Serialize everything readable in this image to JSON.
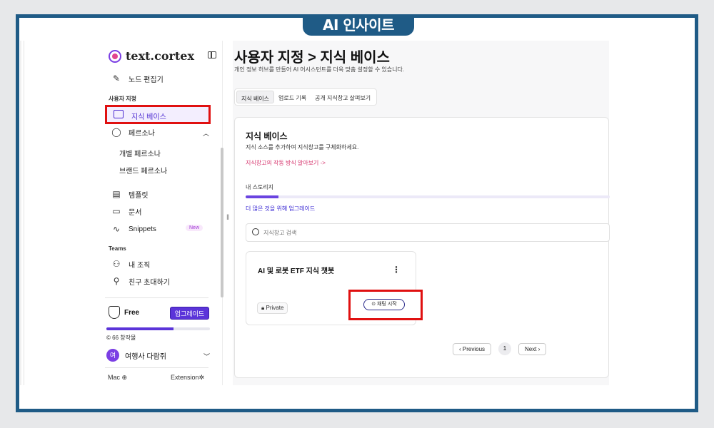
{
  "brand": {
    "label": "AI 인사이트"
  },
  "sidebar": {
    "logo_text": "text.cortex",
    "top_item": "노드 편집기",
    "section_customize": "사용자 지정",
    "active_item": "지식 베이스",
    "personas_label": "페르소나",
    "sub_items": [
      "개별 페르소나",
      "브랜드 페르소나"
    ],
    "items": [
      "템플릿",
      "문서",
      "Snippets"
    ],
    "new_badge": "New",
    "section_teams": "Teams",
    "team_items": [
      "내 조직",
      "친구 초대하기"
    ],
    "plan_name": "Free",
    "upgrade_label": "업그레이드",
    "plan_progress": 0.65,
    "credits": "© 66 창작물",
    "user_initial": "여",
    "user_name": "여행사 다람쥐",
    "footer_left": "Mac ⊕",
    "footer_right": "Extension✲"
  },
  "main": {
    "title": "사용자 지정 > 지식 베이스",
    "description": "개인 정보 허브를 만들어 AI 어시스턴트를 더욱 맞춤 설정할 수 있습니다.",
    "tabs": [
      "지식 베이스",
      "업로드 기록",
      "공개 지식창고 살펴보기"
    ],
    "kb_title": "지식 베이스",
    "kb_desc": "지식 소스를 추가하여 지식창고를 구체화하세요.",
    "kb_link": "지식창고의 작동 방식 알아보기 ->",
    "storage_label": "내 스토리지",
    "storage_progress": 0.09,
    "storage_link": "더 많은 것을 위해 업그레이드",
    "search_placeholder": "지식창고 검색",
    "card": {
      "title": "AI 및 로봇 ETF 지식 챗봇",
      "privacy": "Private",
      "chat_button": "채팅 시작"
    },
    "pager": {
      "prev": "Previous",
      "page": "1",
      "next": "Next"
    }
  }
}
